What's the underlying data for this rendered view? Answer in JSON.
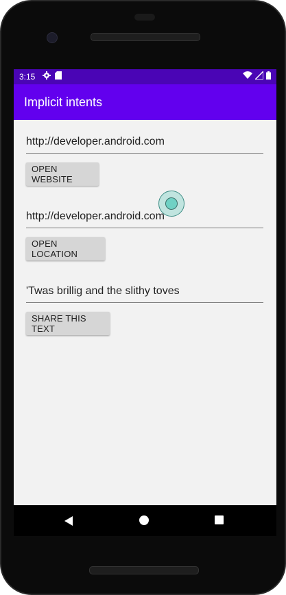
{
  "status_bar": {
    "time": "3:15",
    "left_icons": [
      "gear-icon",
      "sd-card-icon"
    ],
    "right_icons": [
      "wifi-icon",
      "signal-icon",
      "battery-icon"
    ],
    "color": "#4a05b5"
  },
  "app_bar": {
    "title": "Implicit intents",
    "color": "#6200ee"
  },
  "website": {
    "input_value": "http://developer.android.com",
    "button_label": "OPEN WEBSITE"
  },
  "location": {
    "input_value": "http://developer.android.com",
    "button_label": "OPEN LOCATION"
  },
  "share": {
    "input_value": "'Twas brillig and the slithy toves",
    "button_label": "SHARE THIS TEXT"
  },
  "nav_bar": {
    "icons": [
      "back-icon",
      "home-icon",
      "recents-icon"
    ]
  }
}
